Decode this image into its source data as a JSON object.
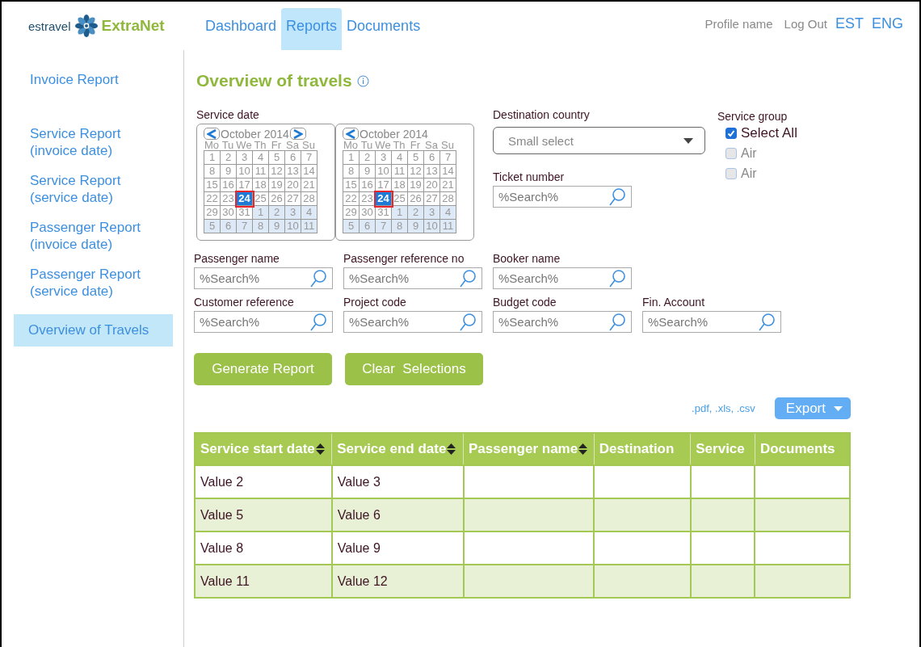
{
  "logo": {
    "brand": "estravel",
    "product": "ExtraNet"
  },
  "nav_tabs": [
    {
      "label": "Dashboard",
      "selected": false
    },
    {
      "label": "Reports",
      "selected": true
    },
    {
      "label": "Documents",
      "selected": false
    }
  ],
  "user_links": [
    "Profile name",
    "Log Out"
  ],
  "languages": [
    "EST",
    "ENG"
  ],
  "sidebar": {
    "items": [
      {
        "label": "Invoice Report",
        "selected": false
      },
      {
        "label": "Service Report (invoice date)",
        "selected": false
      },
      {
        "label": "Service Report (service date)",
        "selected": false
      },
      {
        "label": "Passenger Report (invoice date)",
        "selected": false
      },
      {
        "label": "Passenger Report (service date)",
        "selected": false
      },
      {
        "label": "Overview of Travels",
        "selected": true
      }
    ]
  },
  "page_title": "Overview of travels",
  "service_date": {
    "label": "Service date",
    "calendars": [
      {
        "month": "October 2014",
        "prev": true,
        "next": true,
        "weekdays": [
          "Mo",
          "Tu",
          "We",
          "Th",
          "Fr",
          "Sa",
          "Su"
        ],
        "days": [
          {
            "d": "1",
            "outside": false,
            "selected": false
          },
          {
            "d": "2",
            "outside": false,
            "selected": false
          },
          {
            "d": "3",
            "outside": false,
            "selected": false
          },
          {
            "d": "4",
            "outside": false,
            "selected": false
          },
          {
            "d": "5",
            "outside": false,
            "selected": false
          },
          {
            "d": "6",
            "outside": false,
            "selected": false
          },
          {
            "d": "7",
            "outside": false,
            "selected": false
          },
          {
            "d": "8",
            "outside": false,
            "selected": false
          },
          {
            "d": "9",
            "outside": false,
            "selected": false
          },
          {
            "d": "10",
            "outside": false,
            "selected": false
          },
          {
            "d": "11",
            "outside": false,
            "selected": false
          },
          {
            "d": "12",
            "outside": false,
            "selected": false
          },
          {
            "d": "13",
            "outside": false,
            "selected": false
          },
          {
            "d": "14",
            "outside": false,
            "selected": false
          },
          {
            "d": "15",
            "outside": false,
            "selected": false
          },
          {
            "d": "16",
            "outside": false,
            "selected": false
          },
          {
            "d": "17",
            "outside": false,
            "selected": false
          },
          {
            "d": "18",
            "outside": false,
            "selected": false
          },
          {
            "d": "19",
            "outside": false,
            "selected": false
          },
          {
            "d": "20",
            "outside": false,
            "selected": false
          },
          {
            "d": "21",
            "outside": false,
            "selected": false
          },
          {
            "d": "22",
            "outside": false,
            "selected": false
          },
          {
            "d": "23",
            "outside": false,
            "selected": false
          },
          {
            "d": "24",
            "outside": false,
            "selected": true
          },
          {
            "d": "25",
            "outside": false,
            "selected": false
          },
          {
            "d": "26",
            "outside": false,
            "selected": false
          },
          {
            "d": "27",
            "outside": false,
            "selected": false
          },
          {
            "d": "28",
            "outside": false,
            "selected": false
          },
          {
            "d": "29",
            "outside": false,
            "selected": false
          },
          {
            "d": "30",
            "outside": false,
            "selected": false
          },
          {
            "d": "31",
            "outside": false,
            "selected": false
          },
          {
            "d": "1",
            "outside": true,
            "selected": false
          },
          {
            "d": "2",
            "outside": true,
            "selected": false
          },
          {
            "d": "3",
            "outside": true,
            "selected": false
          },
          {
            "d": "4",
            "outside": true,
            "selected": false
          },
          {
            "d": "5",
            "outside": true,
            "selected": false
          },
          {
            "d": "6",
            "outside": true,
            "selected": false
          },
          {
            "d": "7",
            "outside": true,
            "selected": false
          },
          {
            "d": "8",
            "outside": true,
            "selected": false
          },
          {
            "d": "9",
            "outside": true,
            "selected": false
          },
          {
            "d": "10",
            "outside": true,
            "selected": false
          },
          {
            "d": "11",
            "outside": true,
            "selected": false
          }
        ]
      },
      {
        "month": "October 2014",
        "prev": true,
        "next": false,
        "weekdays": [
          "Mo",
          "Tu",
          "We",
          "Th",
          "Fr",
          "Sa",
          "Su"
        ],
        "days": [
          {
            "d": "1",
            "outside": false,
            "selected": false
          },
          {
            "d": "2",
            "outside": false,
            "selected": false
          },
          {
            "d": "3",
            "outside": false,
            "selected": false
          },
          {
            "d": "4",
            "outside": false,
            "selected": false
          },
          {
            "d": "5",
            "outside": false,
            "selected": false
          },
          {
            "d": "6",
            "outside": false,
            "selected": false
          },
          {
            "d": "7",
            "outside": false,
            "selected": false
          },
          {
            "d": "8",
            "outside": false,
            "selected": false
          },
          {
            "d": "9",
            "outside": false,
            "selected": false
          },
          {
            "d": "10",
            "outside": false,
            "selected": false
          },
          {
            "d": "11",
            "outside": false,
            "selected": false
          },
          {
            "d": "12",
            "outside": false,
            "selected": false
          },
          {
            "d": "13",
            "outside": false,
            "selected": false
          },
          {
            "d": "14",
            "outside": false,
            "selected": false
          },
          {
            "d": "15",
            "outside": false,
            "selected": false
          },
          {
            "d": "16",
            "outside": false,
            "selected": false
          },
          {
            "d": "17",
            "outside": false,
            "selected": false
          },
          {
            "d": "18",
            "outside": false,
            "selected": false
          },
          {
            "d": "19",
            "outside": false,
            "selected": false
          },
          {
            "d": "20",
            "outside": false,
            "selected": false
          },
          {
            "d": "21",
            "outside": false,
            "selected": false
          },
          {
            "d": "22",
            "outside": false,
            "selected": false
          },
          {
            "d": "23",
            "outside": false,
            "selected": false
          },
          {
            "d": "24",
            "outside": false,
            "selected": true
          },
          {
            "d": "25",
            "outside": false,
            "selected": false
          },
          {
            "d": "26",
            "outside": false,
            "selected": false
          },
          {
            "d": "27",
            "outside": false,
            "selected": false
          },
          {
            "d": "28",
            "outside": false,
            "selected": false
          },
          {
            "d": "29",
            "outside": false,
            "selected": false
          },
          {
            "d": "30",
            "outside": false,
            "selected": false
          },
          {
            "d": "31",
            "outside": false,
            "selected": false
          },
          {
            "d": "1",
            "outside": true,
            "selected": false
          },
          {
            "d": "2",
            "outside": true,
            "selected": false
          },
          {
            "d": "3",
            "outside": true,
            "selected": false
          },
          {
            "d": "4",
            "outside": true,
            "selected": false
          },
          {
            "d": "5",
            "outside": true,
            "selected": false
          },
          {
            "d": "6",
            "outside": true,
            "selected": false
          },
          {
            "d": "7",
            "outside": true,
            "selected": false
          },
          {
            "d": "8",
            "outside": true,
            "selected": false
          },
          {
            "d": "9",
            "outside": true,
            "selected": false
          },
          {
            "d": "10",
            "outside": true,
            "selected": false
          },
          {
            "d": "11",
            "outside": true,
            "selected": false
          }
        ]
      }
    ]
  },
  "destination_country": {
    "label": "Destination country",
    "placeholder": "Small select"
  },
  "ticket_number": {
    "label": "Ticket number",
    "placeholder": "%Search%"
  },
  "service_group": {
    "label": "Service group",
    "options": [
      {
        "label": "Select All",
        "checked": true
      },
      {
        "label": "Air",
        "checked": false
      },
      {
        "label": "Air",
        "checked": false
      }
    ]
  },
  "search_rows": [
    [
      {
        "label": "Passenger name",
        "placeholder": "%Search%"
      },
      {
        "label": "Passenger reference no",
        "placeholder": "%Search%"
      },
      {
        "label": "Booker name",
        "placeholder": "%Search%"
      }
    ],
    [
      {
        "label": "Customer reference",
        "placeholder": "%Search%"
      },
      {
        "label": "Project code",
        "placeholder": "%Search%"
      },
      {
        "label": "Budget code",
        "placeholder": "%Search%"
      },
      {
        "label": "Fin. Account",
        "placeholder": "%Search%"
      }
    ]
  ],
  "actions": [
    "Generate Report",
    "Clear  Selections"
  ],
  "export": {
    "formats": ".pdf, .xls, .csv",
    "button": "Export"
  },
  "table": {
    "columns": [
      {
        "label": "Service start date",
        "sortable": true
      },
      {
        "label": "Service end date",
        "sortable": true
      },
      {
        "label": "Passenger name",
        "sortable": true
      },
      {
        "label": "Destination",
        "sortable": false
      },
      {
        "label": "Service",
        "sortable": false
      },
      {
        "label": "Documents",
        "sortable": false
      }
    ],
    "rows": [
      {
        "cells": [
          "Value 2",
          "Value 3"
        ]
      },
      {
        "cells": [
          "Value 5",
          "Value 6"
        ]
      },
      {
        "cells": [
          "Value 8",
          "Value 9"
        ]
      },
      {
        "cells": [
          "Value 11",
          "Value 12"
        ]
      }
    ]
  }
}
